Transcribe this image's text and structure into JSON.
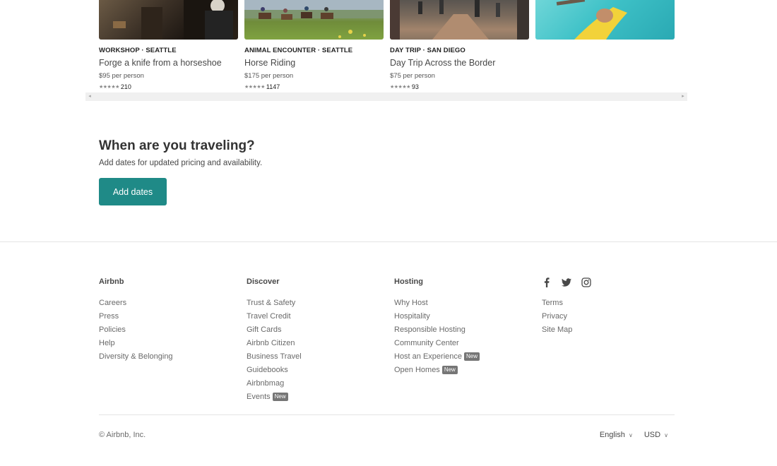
{
  "experiences": [
    {
      "kicker": "WORKSHOP · SEATTLE",
      "title": "Forge a knife from a horseshoe",
      "price": "$95 per person",
      "stars": "★★★★★",
      "reviews": "210"
    },
    {
      "kicker": "ANIMAL ENCOUNTER · SEATTLE",
      "title": "Horse Riding",
      "price": "$175 per person",
      "stars": "★★★★★",
      "reviews": "1147"
    },
    {
      "kicker": "DAY TRIP · SAN DIEGO",
      "title": "Day Trip Across the Border",
      "price": "$75 per person",
      "stars": "★★★★★",
      "reviews": "93"
    }
  ],
  "scrollbar": {
    "left_arrow": "◂",
    "right_arrow": "▸"
  },
  "travel": {
    "heading": "When are you traveling?",
    "subtext": "Add dates for updated pricing and availability.",
    "button": "Add dates"
  },
  "footer": {
    "airbnb": {
      "heading": "Airbnb",
      "links": [
        "Careers",
        "Press",
        "Policies",
        "Help",
        "Diversity & Belonging"
      ]
    },
    "discover": {
      "heading": "Discover",
      "links": [
        "Trust & Safety",
        "Travel Credit",
        "Gift Cards",
        "Airbnb Citizen",
        "Business Travel",
        "Guidebooks",
        "Airbnbmag",
        "Events"
      ]
    },
    "hosting": {
      "heading": "Hosting",
      "links": [
        "Why Host",
        "Hospitality",
        "Responsible Hosting",
        "Community Center",
        "Host an Experience",
        "Open Homes"
      ]
    },
    "legal": {
      "links": [
        "Terms",
        "Privacy",
        "Site Map"
      ]
    },
    "badge": "New",
    "social_icons": [
      "facebook-icon",
      "twitter-icon",
      "instagram-icon"
    ],
    "copyright": "© Airbnb, Inc.",
    "language": "English",
    "currency": "USD",
    "caret": "∨"
  },
  "colors": {
    "accent": "#1f8a87",
    "badge": "#767676",
    "text": "#484848"
  }
}
